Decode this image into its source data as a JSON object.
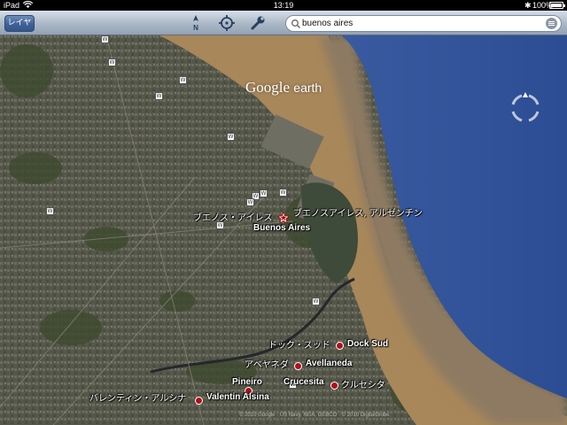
{
  "status_bar": {
    "device": "iPad",
    "time": "13:19",
    "battery": "100%",
    "battery_level": 1.0
  },
  "toolbar": {
    "layers_label": "レイヤ",
    "north_label": "N",
    "search": {
      "value": "buenos aires",
      "placeholder": ""
    }
  },
  "map": {
    "logo_google": "Google",
    "logo_earth": "earth",
    "labels": {
      "buenos_aires_jp_left": "ブエノス・アイレス",
      "buenos_aires_jp_right": "ブエノスアイレス, アルゼンチン",
      "buenos_aires_en": "Buenos Aires",
      "dock_sud_jp": "ドック・スッド",
      "dock_sud_en": "Dock Sud",
      "avellaneda_jp": "アベヤネダ",
      "avellaneda_en": "Avellaneda",
      "pineiro_en": "Pineiro",
      "crucesita_en": "Crucesita",
      "crucesita_jp": "クルセシタ",
      "valentin_alsina_jp": "バレンティン・アルシナ",
      "valentin_alsina_en": "Valentin Alsina"
    },
    "copyright": "© 2010 Google · US Navy, NGA, GEBCO · © 2010 DigitalGlobe"
  },
  "colors": {
    "water": "#2f4f9a",
    "river_silt": "#a8875a",
    "city": "#5c5e4f",
    "marker": "#b0101a"
  }
}
